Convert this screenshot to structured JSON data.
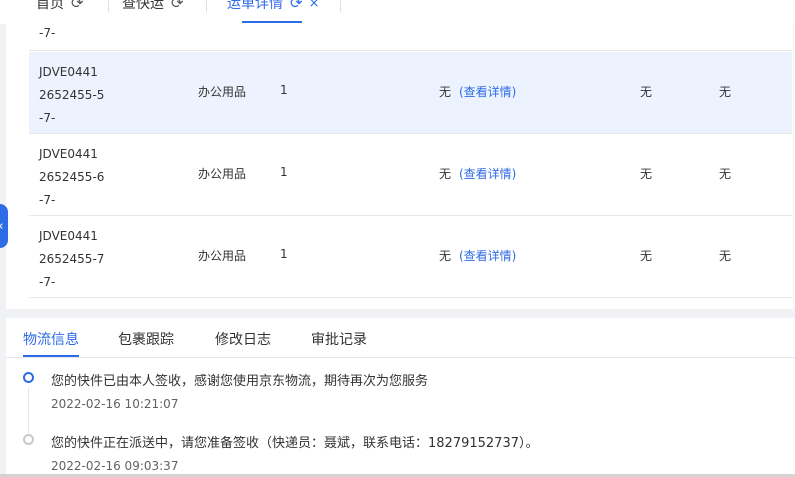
{
  "tabs": [
    {
      "label": "首页",
      "refresh": "⟳"
    },
    {
      "label": "查快运",
      "refresh": "⟳"
    },
    {
      "label": "运单详情",
      "refresh": "⟳",
      "close": "×"
    }
  ],
  "table": {
    "partial_row_id": "-7-",
    "rows": [
      {
        "id_lines": [
          "JDVE0441",
          "2652455-5",
          "-7-"
        ],
        "category": "办公用品",
        "qty": "1",
        "remark": "无",
        "detail_link": "(查看详情)",
        "col_a": "无",
        "col_b": "无"
      },
      {
        "id_lines": [
          "JDVE0441",
          "2652455-6",
          "-7-"
        ],
        "category": "办公用品",
        "qty": "1",
        "remark": "无",
        "detail_link": "(查看详情)",
        "col_a": "无",
        "col_b": "无"
      },
      {
        "id_lines": [
          "JDVE0441",
          "2652455-7",
          "-7-"
        ],
        "category": "办公用品",
        "qty": "1",
        "remark": "无",
        "detail_link": "(查看详情)",
        "col_a": "无",
        "col_b": "无"
      }
    ]
  },
  "collapse_handle": "‹",
  "bottom_tabs": [
    "物流信息",
    "包裹跟踪",
    "修改日志",
    "审批记录"
  ],
  "timeline": [
    {
      "text": "您的快件已由本人签收，感谢您使用京东物流，期待再次为您服务",
      "time": "2022-02-16 10:21:07"
    },
    {
      "text": "您的快件正在派送中，请您准备签收（快递员：聂斌，联系电话：18279152737）。",
      "time": "2022-02-16 09:03:37"
    }
  ],
  "colors": {
    "accent": "#2e6be6",
    "row_hover": "#ecf3fe"
  }
}
